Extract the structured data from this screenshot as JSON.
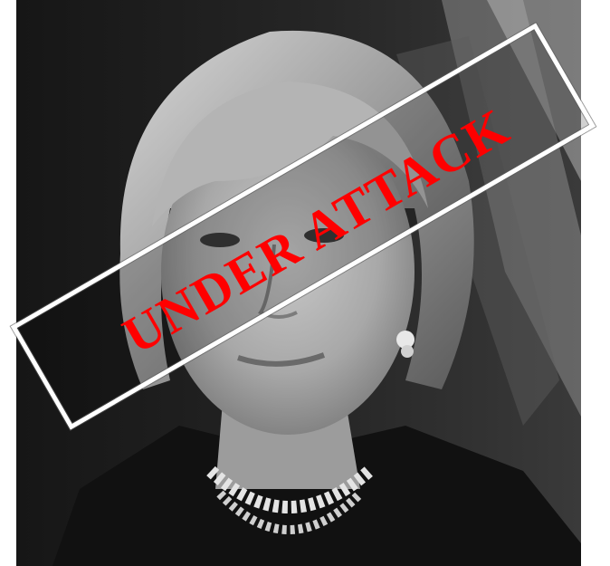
{
  "stamp": {
    "text": "UNDER ATTACK",
    "text_color": "#ff0000",
    "border_color": "#ffffff"
  },
  "photo": {
    "style": "black-and-white portrait",
    "background_color": "#1c1c1c"
  }
}
